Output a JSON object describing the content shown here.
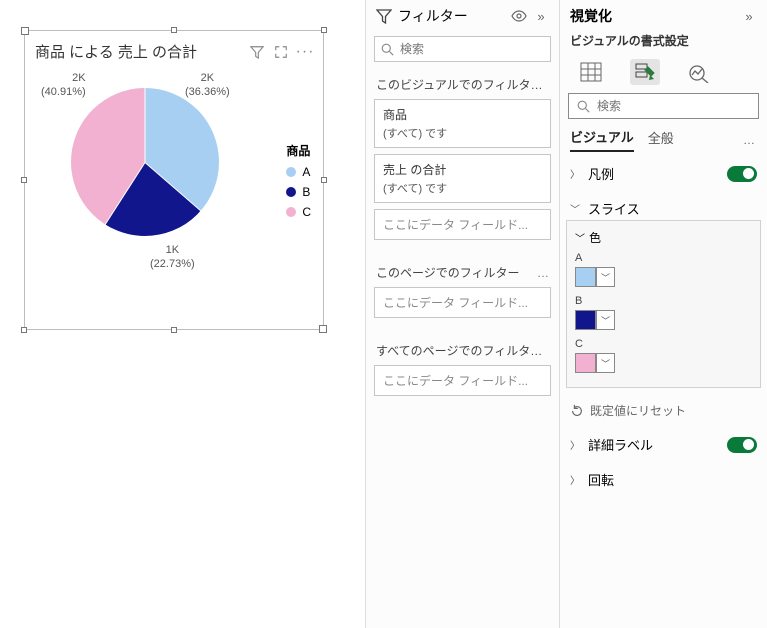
{
  "chart": {
    "title": "商品 による 売上 の合計",
    "legend_title": "商品",
    "labels": {
      "a": {
        "value": "2K",
        "pct": "(36.36%)"
      },
      "b": {
        "value": "1K",
        "pct": "(22.73%)"
      },
      "c": {
        "value": "2K",
        "pct": "(40.91%)"
      }
    }
  },
  "chart_data": {
    "type": "pie",
    "title": "商品 による 売上 の合計",
    "series": [
      {
        "name": "A",
        "value": 2000,
        "pct": 36.36,
        "color": "#a6cff1"
      },
      {
        "name": "B",
        "value": 1000,
        "pct": 22.73,
        "color": "#11168c"
      },
      {
        "name": "C",
        "value": 2000,
        "pct": 40.91,
        "color": "#f2b1d0"
      }
    ],
    "value_label": "売上 の合計",
    "category_label": "商品"
  },
  "filters": {
    "title": "フィルター",
    "search_placeholder": "検索",
    "sections": {
      "visual": "このビジュアルでのフィルター…",
      "page": "このページでのフィルター",
      "all": "すべてのページでのフィルター…"
    },
    "cards": {
      "c1": {
        "name": "商品",
        "value": "(すべて) です"
      },
      "c2": {
        "name": "売上 の合計",
        "value": "(すべて) です"
      }
    },
    "drop_text": "ここにデータ フィールド..."
  },
  "viz": {
    "title": "視覚化",
    "subtitle": "ビジュアルの書式設定",
    "search_placeholder": "検索",
    "tabs": {
      "visual": "ビジュアル",
      "general": "全般",
      "more": "…"
    },
    "props": {
      "legend": "凡例",
      "slices": "スライス",
      "colors": "色",
      "detail": "詳細ラベル",
      "rotation": "回転"
    },
    "color_items": {
      "a": {
        "label": "A",
        "color": "#a6cff1"
      },
      "b": {
        "label": "B",
        "color": "#11168c"
      },
      "c": {
        "label": "C",
        "color": "#f2b1d0"
      }
    },
    "reset": "既定値にリセット"
  }
}
